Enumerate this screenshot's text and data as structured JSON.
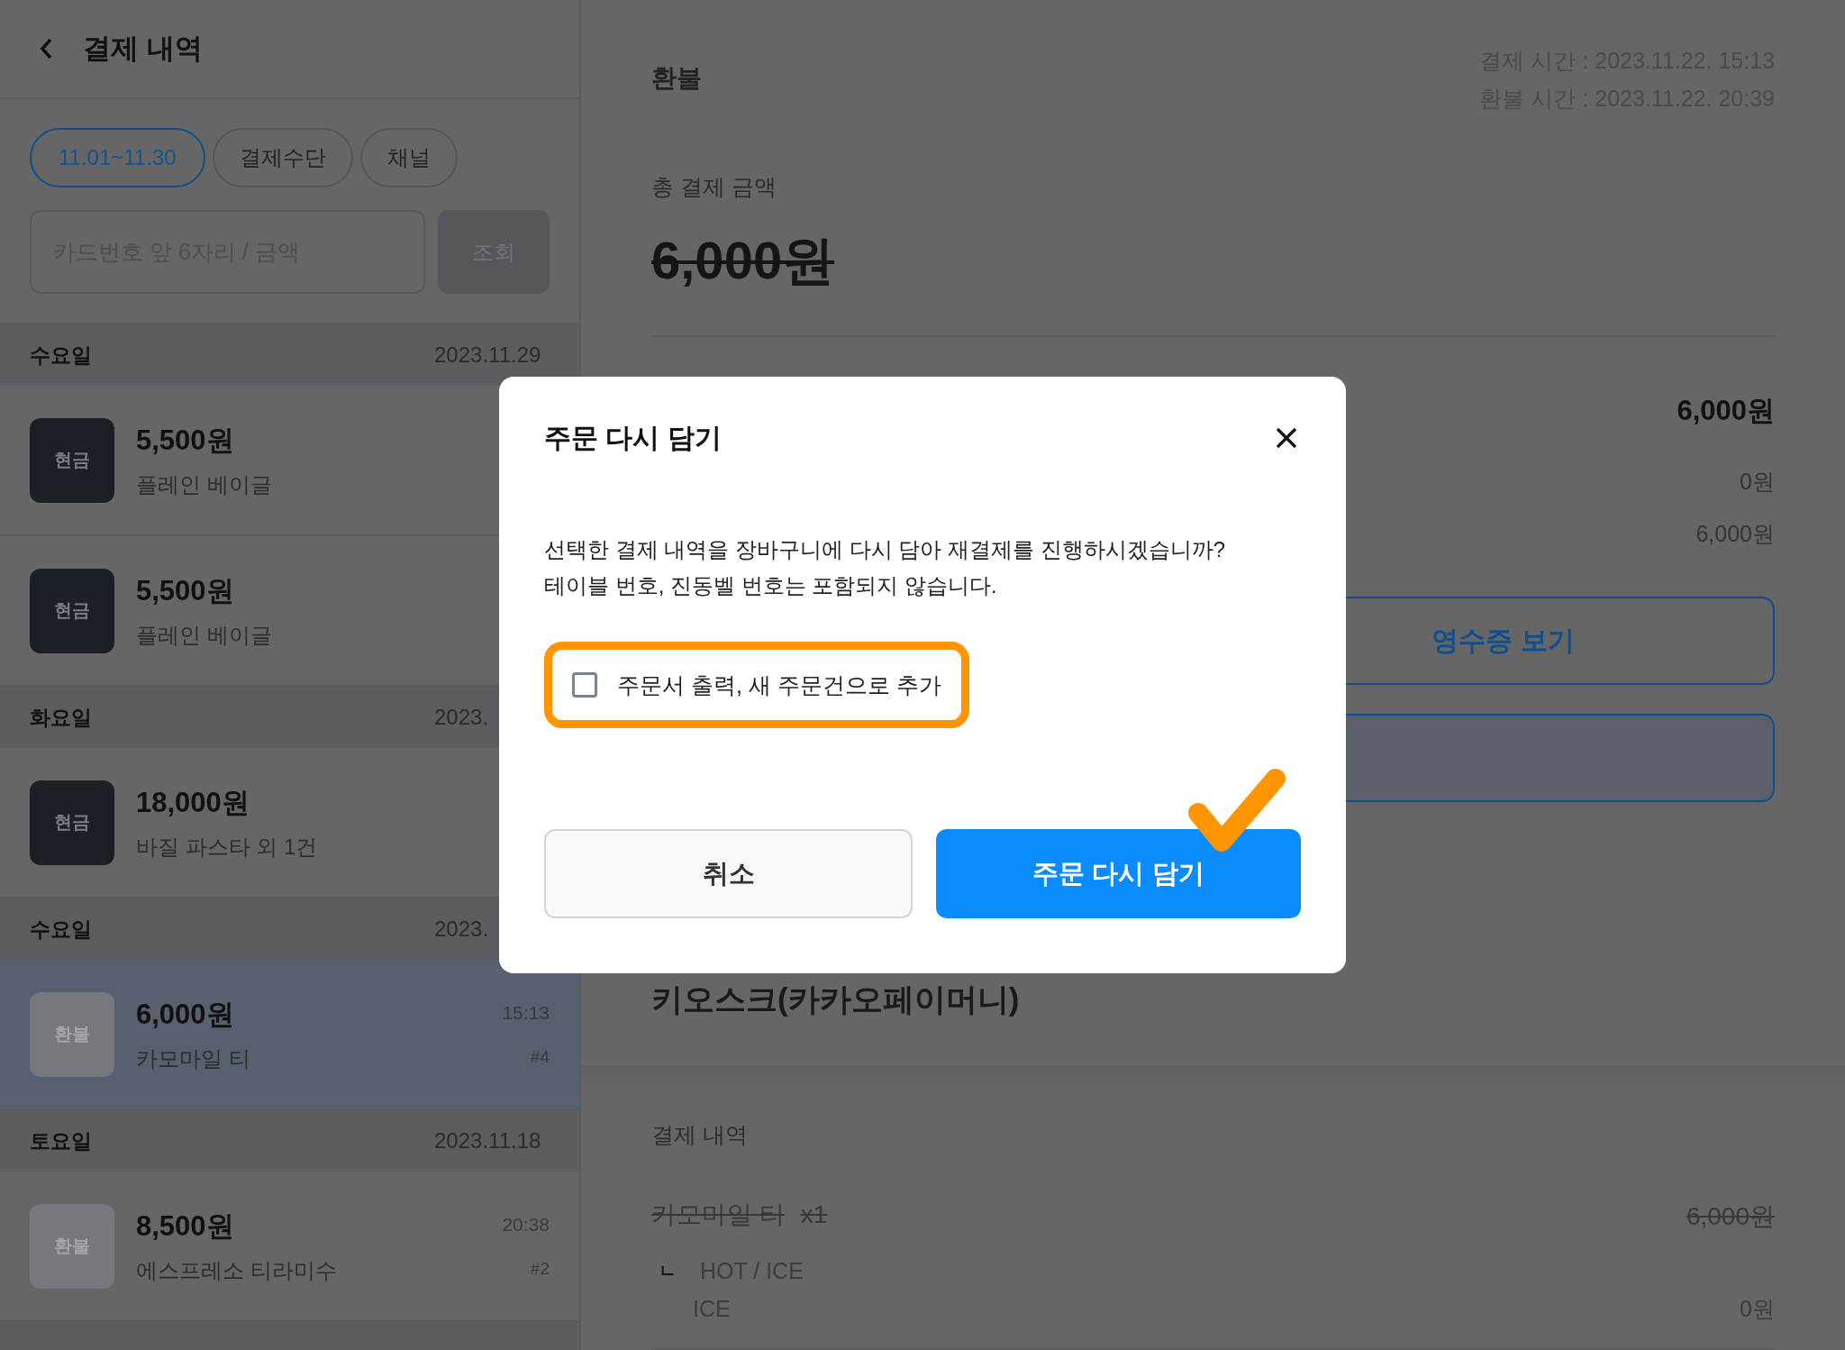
{
  "header": {
    "title": "결제 내역"
  },
  "filters": [
    {
      "label": "11.01~11.30",
      "selected": true
    },
    {
      "label": "결제수단",
      "selected": false
    },
    {
      "label": "채널",
      "selected": false
    }
  ],
  "search": {
    "placeholder": "카드번호 앞 6자리 / 금액",
    "button": "조회",
    "disabled": true
  },
  "days": [
    {
      "day": "수요일",
      "date": "2023.11.29",
      "payments": [
        {
          "kind": "cash",
          "badge": "현금",
          "amount": "5,500원",
          "item": "플레인 베이글",
          "selected": false
        },
        {
          "kind": "cash",
          "badge": "현금",
          "amount": "5,500원",
          "item": "플레인 베이글",
          "selected": false
        }
      ]
    },
    {
      "day": "화요일",
      "date": "2023.",
      "payments": [
        {
          "kind": "cash",
          "badge": "현금",
          "amount": "18,000원",
          "item": "바질 파스타 외 1건",
          "selected": false
        }
      ]
    },
    {
      "day": "수요일",
      "date": "2023.",
      "payments": [
        {
          "kind": "refund",
          "badge": "환불",
          "amount": "6,000원",
          "item": "카모마일 티",
          "time": "15:13",
          "order": "#4",
          "selected": true
        }
      ]
    },
    {
      "day": "토요일",
      "date": "2023.11.18",
      "payments": [
        {
          "kind": "refund",
          "badge": "환불",
          "amount": "8,500원",
          "item": "에스프레소 티라미수",
          "time": "20:38",
          "order": "#2",
          "selected": false
        }
      ]
    }
  ],
  "detail": {
    "status": "환불",
    "paid_time": "결제 시간 : 2023.11.22. 15:13",
    "refund_time": "환불 시간 : 2023.11.22. 20:39",
    "total_label": "총 결제 금액",
    "total": "6,000원",
    "refunded": true,
    "summary": [
      {
        "value": "6,000원",
        "emphasis": true
      },
      {
        "value": "0원",
        "emphasis": false
      },
      {
        "value": "6,000원",
        "emphasis": false
      }
    ],
    "buttons": [
      {
        "kind": "outline",
        "label": "영수증 보기"
      },
      {
        "kind": "tinted"
      }
    ],
    "channel": "키오스크(카카오페이머니)",
    "history_title": "결제 내역",
    "items": [
      {
        "name": "카모마일 티",
        "qty": "x1",
        "price": "6,000원",
        "cancelled": true,
        "options": [
          {
            "marker": "ㄴ",
            "group": "HOT / ICE",
            "choice": "ICE",
            "price": "0원"
          }
        ]
      }
    ]
  },
  "dialog": {
    "title": "주문 다시 담기",
    "message": "선택한 결제 내역을 장바구니에 다시 담아 재결제를 진행하시겠습니까?\n테이블 번호, 진동벨 번호는 포함되지 않습니다.",
    "option": {
      "label": "주문서 출력, 새 주문건으로 추가",
      "checked": false,
      "highlighted": true
    },
    "buttons": [
      {
        "kind": "secondary",
        "label": "취소",
        "ticked": false
      },
      {
        "kind": "primary",
        "label": "주문 다시 담기",
        "ticked": true
      }
    ]
  }
}
